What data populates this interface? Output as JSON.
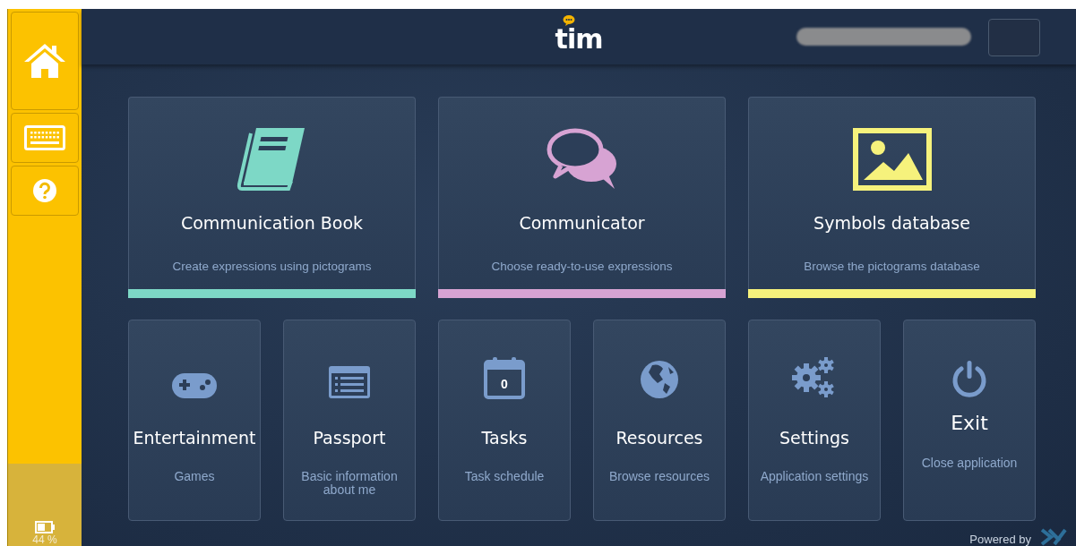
{
  "sidebar": {
    "buttons": [
      {
        "kind": "home"
      },
      {
        "kind": "keyboard"
      },
      {
        "kind": "help"
      }
    ],
    "battery": {
      "reading": "44 %"
    }
  },
  "header": {
    "logo": "tim"
  },
  "features": [
    {
      "kind": "book",
      "title": "Communication Book",
      "subtitle": "Create expressions using pictograms",
      "color": "#7dd8c6"
    },
    {
      "kind": "chat",
      "title": "Communicator",
      "subtitle": "Choose ready-to-use expressions",
      "color": "#d7a3d3"
    },
    {
      "kind": "image",
      "title": "Symbols database",
      "subtitle": "Browse the pictograms database",
      "color": "#f6f27c"
    }
  ],
  "tiles": [
    {
      "kind": "gamepad",
      "title": "Entertainment",
      "subtitle": "Games"
    },
    {
      "kind": "list",
      "title": "Passport",
      "subtitle": "Basic information about me"
    },
    {
      "kind": "calendar",
      "title": "Tasks",
      "subtitle": "Task schedule",
      "badge": "0"
    },
    {
      "kind": "globe",
      "title": "Resources",
      "subtitle": "Browse resources"
    },
    {
      "kind": "gears",
      "title": "Settings",
      "subtitle": "Application settings"
    },
    {
      "kind": "power",
      "title": "Exit",
      "subtitle": "Close application"
    }
  ],
  "footer": {
    "powered_by": "Powered by"
  }
}
